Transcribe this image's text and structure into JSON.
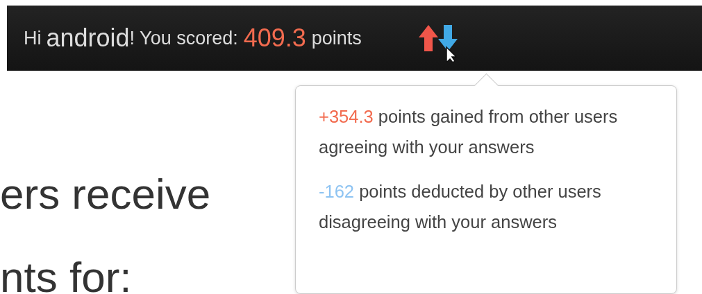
{
  "header": {
    "greeting": "Hi",
    "username": "android",
    "after_name": "! You scored:",
    "score": "409.3",
    "unit": "points"
  },
  "tooltip": {
    "items": [
      {
        "kind": "gain",
        "amount": "+354.3",
        "text": "points gained from other users agreeing with your answers"
      },
      {
        "kind": "loss",
        "amount": "-162",
        "text": "points deducted by other users disagreeing with your answers"
      }
    ]
  },
  "body_lines": [
    "ers receive",
    "nts for:"
  ]
}
